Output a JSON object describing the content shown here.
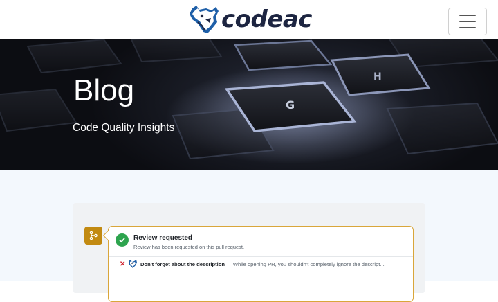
{
  "header": {
    "brand": "codeac",
    "logo_icon": "bear-head-logo",
    "menu_icon": "hamburger-menu-icon"
  },
  "hero": {
    "title": "Blog",
    "subtitle": "Code Quality Insights",
    "key_labels": [
      "G",
      "H"
    ]
  },
  "pr_card": {
    "badge_icon": "git-pull-request-icon",
    "status_icon": "check-circle-icon",
    "title": "Review requested",
    "description": "Review has been requested on this pull request.",
    "issue": {
      "icon": "x-icon",
      "bot_icon": "codeac-bot-icon",
      "title": "Don't forget about the description",
      "text": " — While opening PR, you shouldn't completely ignore the descript..."
    }
  },
  "colors": {
    "brand_navy": "#1d2541",
    "brand_blue": "#1e5fa8",
    "badge_gold": "#c28a11",
    "success_green": "#2da44e",
    "error_red": "#cf222e",
    "page_bg": "#f3f8fd"
  }
}
